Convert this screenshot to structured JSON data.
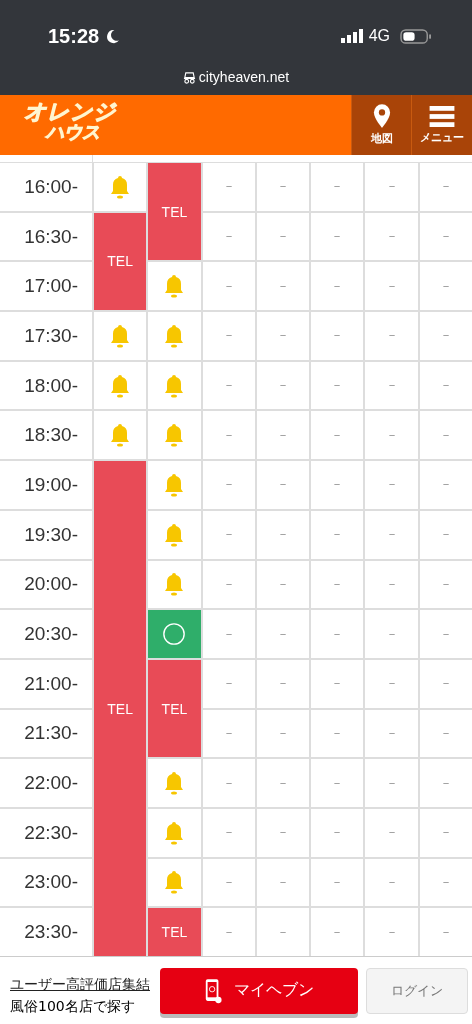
{
  "status_bar": {
    "time": "15:28",
    "network": "4G"
  },
  "address_bar": {
    "url": "cityheaven.net"
  },
  "header": {
    "logo_lines": [
      "オレンジ",
      "ハウス"
    ],
    "buttons": [
      {
        "kind": "map",
        "label": "地図"
      },
      {
        "kind": "menu",
        "label": "メニュー"
      }
    ]
  },
  "schedule": {
    "times": [
      "16:00-",
      "16:30-",
      "17:00-",
      "17:30-",
      "18:00-",
      "18:30-",
      "19:00-",
      "19:30-",
      "20:00-",
      "20:30-",
      "21:00-",
      "21:30-",
      "22:00-",
      "22:30-",
      "23:00-",
      "23:30-"
    ],
    "columns": [
      {
        "cells": [
          {
            "kind": "bell"
          },
          {
            "kind": "tel",
            "text": "TEL"
          },
          {
            "kind": "tel_cont"
          },
          {
            "kind": "bell"
          },
          {
            "kind": "bell"
          },
          {
            "kind": "bell"
          },
          {
            "kind": "tel",
            "text": "TEL"
          },
          {
            "kind": "tel_cont"
          },
          {
            "kind": "tel_cont"
          },
          {
            "kind": "tel_cont"
          },
          {
            "kind": "tel_cont"
          },
          {
            "kind": "tel_cont"
          },
          {
            "kind": "tel_cont"
          },
          {
            "kind": "tel_cont"
          },
          {
            "kind": "tel_cont"
          },
          {
            "kind": "tel_cont"
          }
        ]
      },
      {
        "cells": [
          {
            "kind": "tel",
            "text": "TEL"
          },
          {
            "kind": "tel_cont"
          },
          {
            "kind": "bell"
          },
          {
            "kind": "bell"
          },
          {
            "kind": "bell"
          },
          {
            "kind": "bell"
          },
          {
            "kind": "bell"
          },
          {
            "kind": "bell"
          },
          {
            "kind": "bell"
          },
          {
            "kind": "open"
          },
          {
            "kind": "tel",
            "text": "TEL"
          },
          {
            "kind": "tel_cont"
          },
          {
            "kind": "bell"
          },
          {
            "kind": "bell"
          },
          {
            "kind": "bell"
          },
          {
            "kind": "tel",
            "text": "TEL"
          }
        ]
      },
      {
        "dash": "－"
      },
      {
        "dash": "－"
      },
      {
        "dash": "－"
      },
      {
        "dash": "－"
      },
      {
        "dash": "－"
      }
    ]
  },
  "footer": {
    "link_lines": [
      "ユーザー高評価店集結",
      "風俗100名店で探す"
    ],
    "myheaven_button": "マイヘブン",
    "login_button": "ログイン"
  }
}
